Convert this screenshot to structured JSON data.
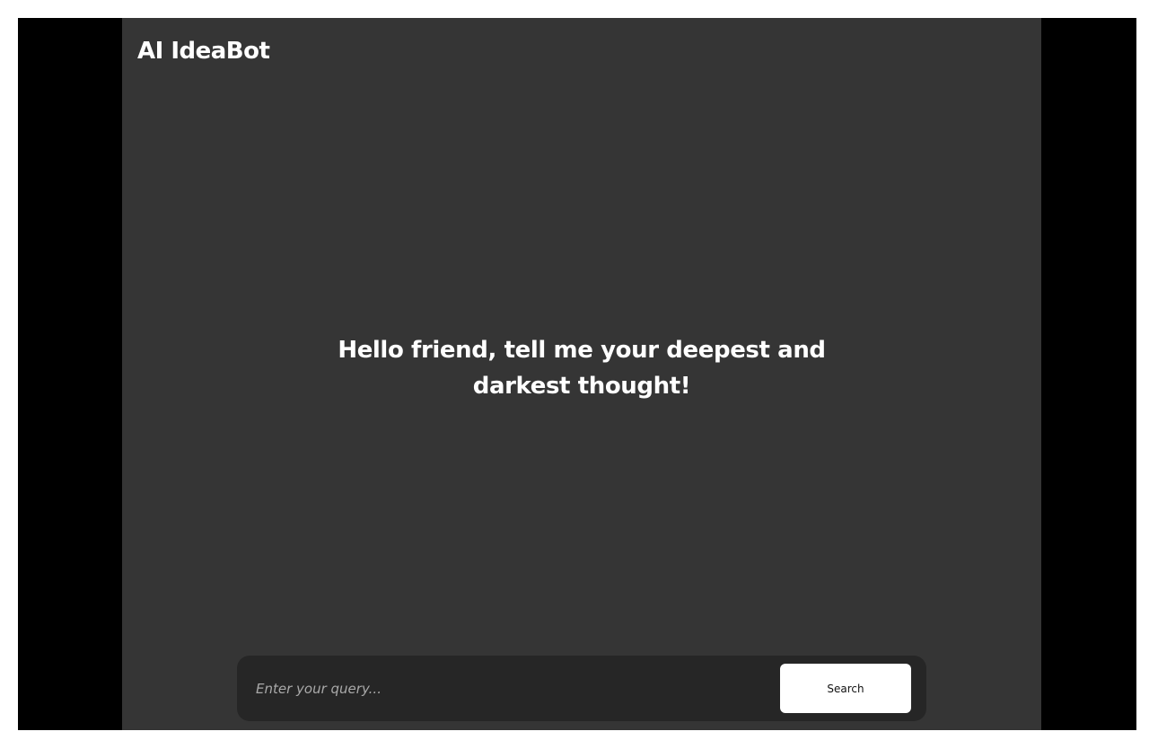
{
  "app": {
    "title": "AI IdeaBot"
  },
  "main": {
    "greeting": "Hello friend, tell me your deepest and darkest thought!"
  },
  "query": {
    "placeholder": "Enter your query...",
    "value": "",
    "search_label": "Search"
  },
  "colors": {
    "page_background": "#ffffff",
    "frame_background": "#000000",
    "app_background": "#353535",
    "query_bar_background": "#262626",
    "button_background": "#ffffff",
    "text_primary": "#ffffff"
  }
}
